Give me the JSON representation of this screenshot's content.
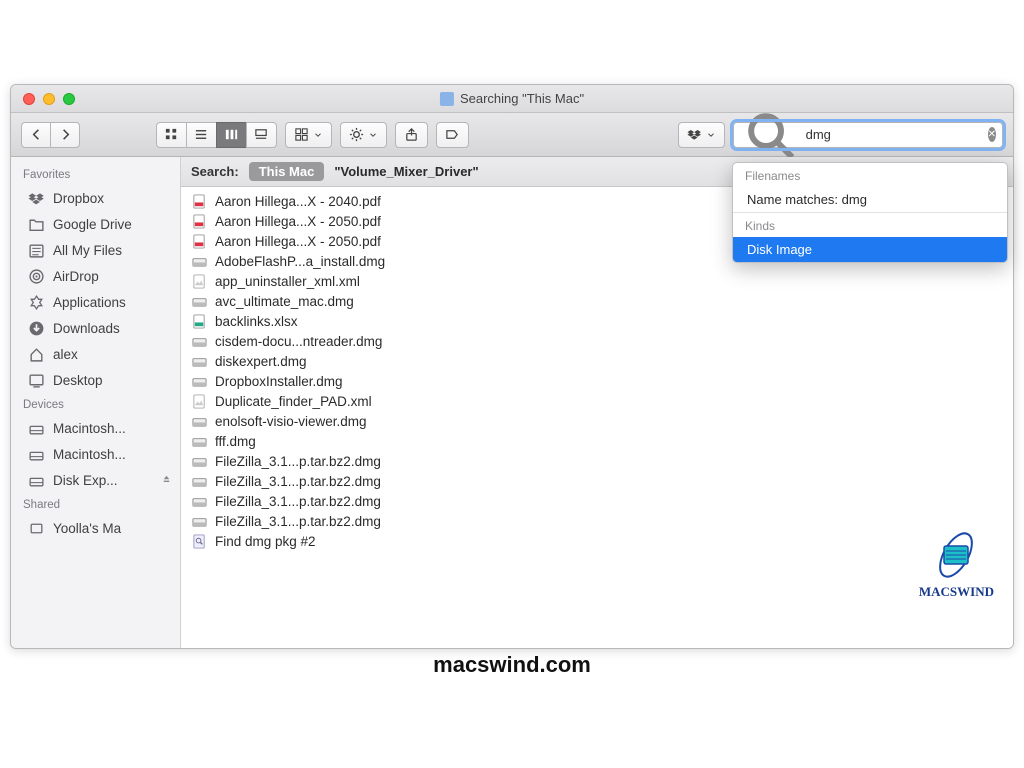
{
  "window": {
    "title": "Searching \"This Mac\""
  },
  "search": {
    "value": "dmg",
    "label": "Search:",
    "scope_selected": "This Mac",
    "scope_other": "\"Volume_Mixer_Driver\""
  },
  "popover": {
    "group1_header": "Filenames",
    "group1_option": "Name matches: dmg",
    "group2_header": "Kinds",
    "group2_option": "Disk Image"
  },
  "sidebar": {
    "favorites_header": "Favorites",
    "devices_header": "Devices",
    "shared_header": "Shared",
    "favorites": [
      {
        "label": "Dropbox",
        "icon": "dropbox"
      },
      {
        "label": "Google Drive",
        "icon": "folder"
      },
      {
        "label": "All My Files",
        "icon": "allfiles"
      },
      {
        "label": "AirDrop",
        "icon": "airdrop"
      },
      {
        "label": "Applications",
        "icon": "apps"
      },
      {
        "label": "Downloads",
        "icon": "downloads"
      },
      {
        "label": "alex",
        "icon": "home"
      },
      {
        "label": "Desktop",
        "icon": "desktop"
      }
    ],
    "devices": [
      {
        "label": "Macintosh..."
      },
      {
        "label": "Macintosh..."
      },
      {
        "label": "Disk Exp...",
        "eject": true
      }
    ],
    "shared": [
      {
        "label": "Yoolla's Ma"
      }
    ]
  },
  "files": [
    {
      "name": "Aaron Hillega...X - 2040.pdf",
      "icon": "pdf"
    },
    {
      "name": "Aaron Hillega...X - 2050.pdf",
      "icon": "pdf"
    },
    {
      "name": "Aaron Hillega...X - 2050.pdf",
      "icon": "pdf"
    },
    {
      "name": "AdobeFlashP...a_install.dmg",
      "icon": "dmg"
    },
    {
      "name": "app_uninstaller_xml.xml",
      "icon": "doc"
    },
    {
      "name": "avc_ultimate_mac.dmg",
      "icon": "dmg"
    },
    {
      "name": "backlinks.xlsx",
      "icon": "xls"
    },
    {
      "name": "cisdem-docu...ntreader.dmg",
      "icon": "dmg"
    },
    {
      "name": "diskexpert.dmg",
      "icon": "dmg"
    },
    {
      "name": "DropboxInstaller.dmg",
      "icon": "dmg"
    },
    {
      "name": "Duplicate_finder_PAD.xml",
      "icon": "doc"
    },
    {
      "name": "enolsoft-visio-viewer.dmg",
      "icon": "dmg"
    },
    {
      "name": "fff.dmg",
      "icon": "dmg"
    },
    {
      "name": "FileZilla_3.1...p.tar.bz2.dmg",
      "icon": "dmg"
    },
    {
      "name": "FileZilla_3.1...p.tar.bz2.dmg",
      "icon": "dmg"
    },
    {
      "name": "FileZilla_3.1...p.tar.bz2.dmg",
      "icon": "dmg"
    },
    {
      "name": "FileZilla_3.1...p.tar.bz2.dmg",
      "icon": "dmg"
    },
    {
      "name": "Find dmg pkg #2",
      "icon": "search"
    }
  ],
  "watermark": {
    "brand": "MACSWIND",
    "url": "macswind.com"
  }
}
